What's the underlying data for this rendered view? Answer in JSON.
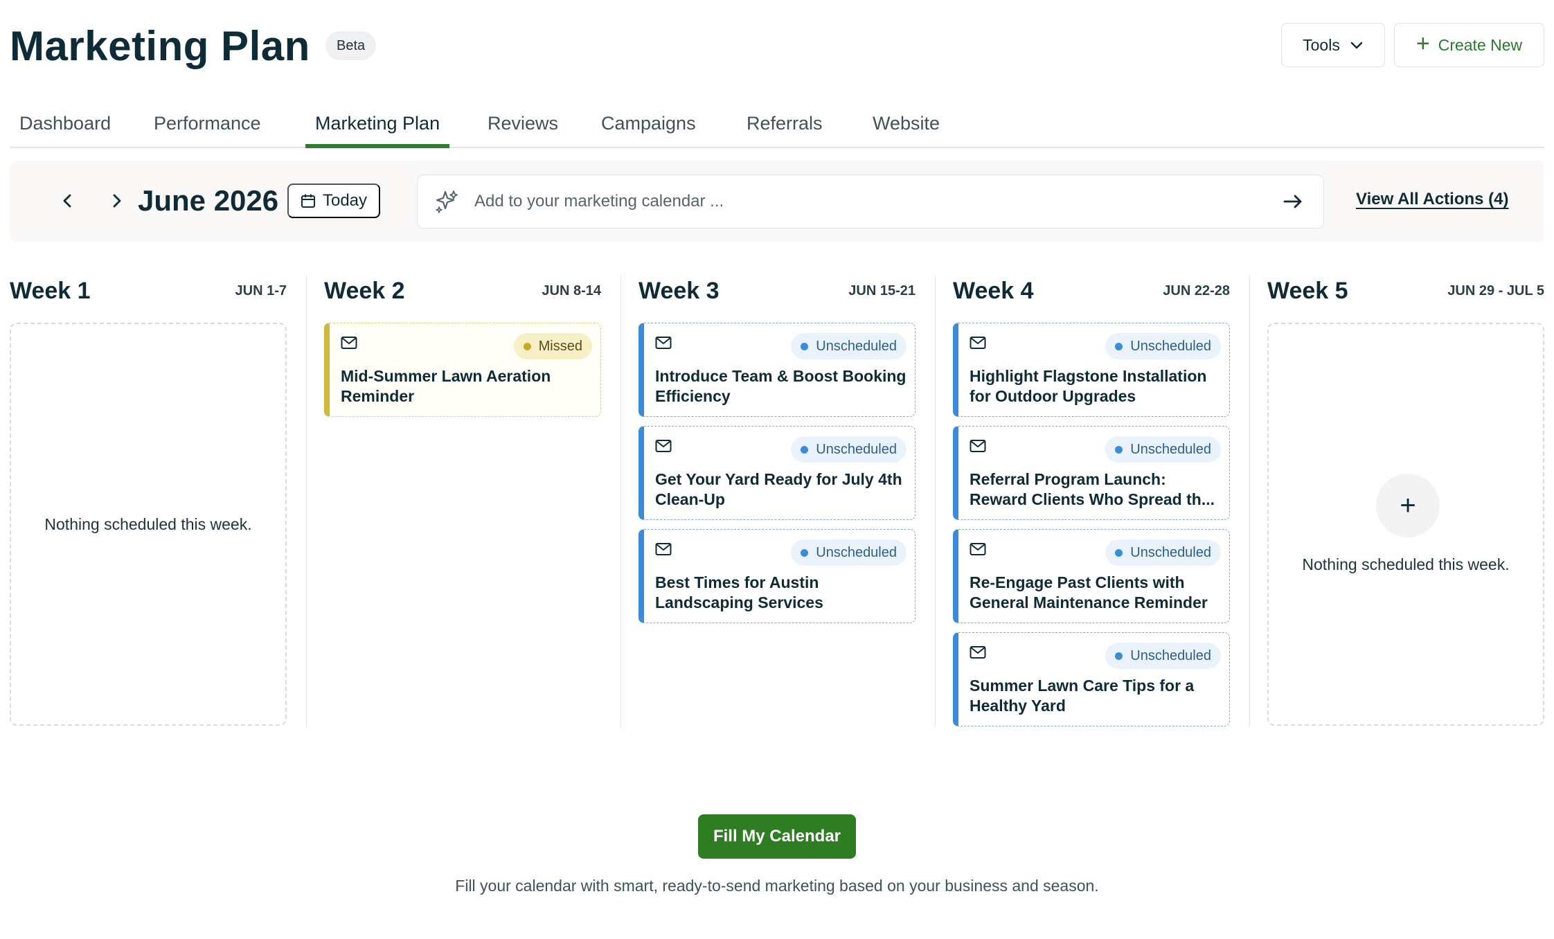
{
  "header": {
    "title": "Marketing Plan",
    "badge": "Beta",
    "tools_label": "Tools",
    "create_label": "Create New"
  },
  "tabs": [
    {
      "label": "Dashboard",
      "active": false
    },
    {
      "label": "Performance",
      "active": false
    },
    {
      "label": "Marketing Plan",
      "active": true
    },
    {
      "label": "Reviews",
      "active": false
    },
    {
      "label": "Campaigns",
      "active": false
    },
    {
      "label": "Referrals",
      "active": false
    },
    {
      "label": "Website",
      "active": false
    }
  ],
  "toolbar": {
    "month": "June 2026",
    "today_label": "Today",
    "ai_placeholder": "Add to your marketing calendar ...",
    "view_all_label": "View All Actions (4)"
  },
  "weeks": [
    {
      "title": "Week 1",
      "range": "JUN 1-7",
      "empty_text": "Nothing scheduled this week.",
      "cards": []
    },
    {
      "title": "Week 2",
      "range": "JUN 8-14",
      "cards": [
        {
          "status": "Missed",
          "title": "Mid-Summer Lawn Aeration Reminder"
        }
      ]
    },
    {
      "title": "Week 3",
      "range": "JUN 15-21",
      "cards": [
        {
          "status": "Unscheduled",
          "title": "Introduce Team & Boost Booking Efficiency"
        },
        {
          "status": "Unscheduled",
          "title": "Get Your Yard Ready for July 4th Clean-Up"
        },
        {
          "status": "Unscheduled",
          "title": "Best Times for Austin Landscaping Services"
        }
      ]
    },
    {
      "title": "Week 4",
      "range": "JUN 22-28",
      "cards": [
        {
          "status": "Unscheduled",
          "title": "Highlight Flagstone Installation for Outdoor Upgrades"
        },
        {
          "status": "Unscheduled",
          "title": "Referral Program Launch: Reward Clients Who Spread th..."
        },
        {
          "status": "Unscheduled",
          "title": "Re-Engage Past Clients with General Maintenance Reminder"
        },
        {
          "status": "Unscheduled",
          "title": "Summer Lawn Care Tips for a Healthy Yard"
        }
      ]
    },
    {
      "title": "Week 5",
      "range": "JUN 29 - JUL 5",
      "empty_text": "Nothing scheduled this week.",
      "cards": []
    }
  ],
  "cta": {
    "button_label": "Fill My Calendar",
    "description": "Fill your calendar with smart, ready-to-send marketing based on your business and season."
  },
  "icons": {
    "prev": "chevron-left-icon",
    "next": "chevron-right-icon",
    "calendar": "calendar-icon",
    "sparkle": "sparkle-icon",
    "submit": "arrow-right-icon",
    "mail": "mail-icon",
    "add": "plus-icon",
    "dropdown": "chevron-down-icon"
  },
  "colors": {
    "brand_green": "#2e7d23",
    "unscheduled_blue": "#3a8bd8",
    "missed_yellow": "#d1b73d"
  }
}
